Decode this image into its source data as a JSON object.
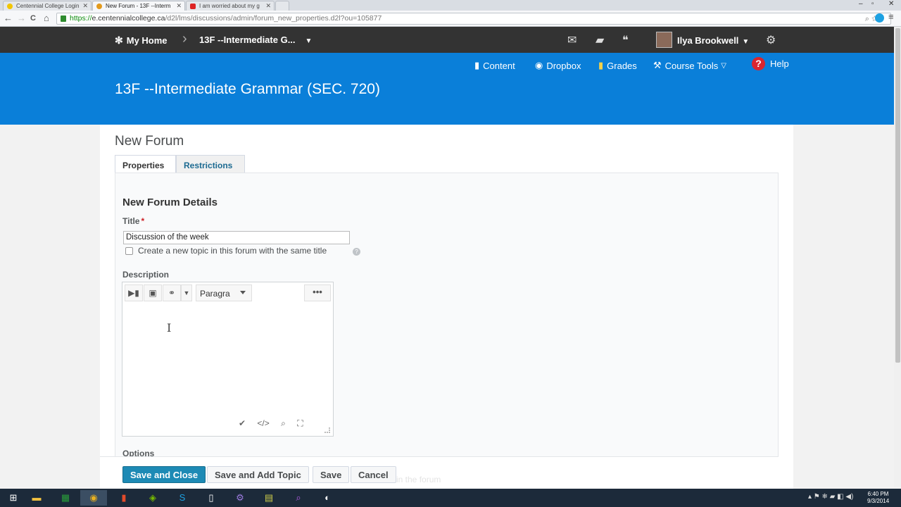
{
  "browser": {
    "tabs": [
      {
        "label": "Centennial College Login",
        "active": false
      },
      {
        "label": "New Forum - 13F --Interm",
        "active": true
      },
      {
        "label": "I am worried about my g",
        "active": false
      }
    ],
    "url_https": "https://",
    "url_host": "e.centennialcollege.ca",
    "url_rest": "/d2l/lms/discussions/admin/forum_new_properties.d2l?ou=105877",
    "back": "←",
    "forward": "→",
    "reload": "C",
    "home": "⌂",
    "win_min": "–",
    "win_max": "▫",
    "win_close": "✕"
  },
  "minibar": {
    "home_label": "My Home",
    "course_label": "13F --Intermediate G...",
    "user_name": "Ilya Brookwell"
  },
  "navbar": {
    "items": [
      {
        "label": "Content",
        "icon": "book-icon"
      },
      {
        "label": "Dropbox",
        "icon": "dropbox-icon"
      },
      {
        "label": "Grades",
        "icon": "grades-icon"
      },
      {
        "label": "Course Tools",
        "icon": "tools-icon"
      },
      {
        "label": "Help",
        "icon": "help-icon"
      }
    ],
    "course_title": "13F --Intermediate Grammar (SEC. 720)"
  },
  "page": {
    "title": "New Forum",
    "tabs": [
      {
        "label": "Properties",
        "selected": true
      },
      {
        "label": "Restrictions",
        "selected": false
      }
    ],
    "section_heading": "New Forum Details",
    "title_label": "Title",
    "required_mark": "*",
    "title_value": "Discussion of the week",
    "checkbox_label": "Create a new topic in this forum with the same title",
    "description_label": "Description",
    "editor": {
      "format_select": "Paragra",
      "more": "•••"
    },
    "options_label": "Options",
    "ghost_text": "in the forum",
    "buttons": {
      "save_close": "Save and Close",
      "save_add_topic": "Save and Add Topic",
      "save": "Save",
      "cancel": "Cancel"
    }
  },
  "taskbar": {
    "time": "6:40 PM",
    "date": "9/3/2014"
  },
  "colors": {
    "navbar": "#0a7fd9",
    "minibar": "#333333",
    "primary_button": "#1d8ab5",
    "link": "#1c6a91"
  }
}
